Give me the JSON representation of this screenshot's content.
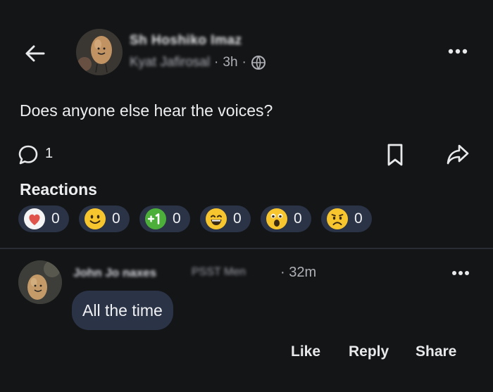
{
  "header": {
    "author_name": "Sh Hoshiko Imaz",
    "group_name": "Kyat Jafirosal",
    "time": "3h",
    "separator": "·",
    "visibility_icon": "globe-icon",
    "more_icon": "more-horizontal-icon",
    "back_icon": "arrow-left-icon"
  },
  "post": {
    "text": "Does anyone else hear the voices?",
    "comment_count": "1"
  },
  "reactions": {
    "title": "Reactions",
    "items": [
      {
        "icon": "heart-icon",
        "count": "0"
      },
      {
        "icon": "smile-emoji-icon",
        "count": "0"
      },
      {
        "icon": "plus-one-icon",
        "count": "0"
      },
      {
        "icon": "grin-emoji-icon",
        "count": "0"
      },
      {
        "icon": "surprised-emoji-icon",
        "count": "0"
      },
      {
        "icon": "sad-emoji-icon",
        "count": "0"
      }
    ]
  },
  "comment": {
    "author": "John Jo naxes",
    "separator": "·",
    "subtitle": "PSST Men",
    "time": "32m",
    "text": "All the time",
    "actions": {
      "like": "Like",
      "reply": "Reply",
      "share": "Share"
    }
  },
  "colors": {
    "background": "#141517",
    "bubble": "#2b3347",
    "text": "#e8e9eb",
    "muted": "#aeb0b5"
  }
}
